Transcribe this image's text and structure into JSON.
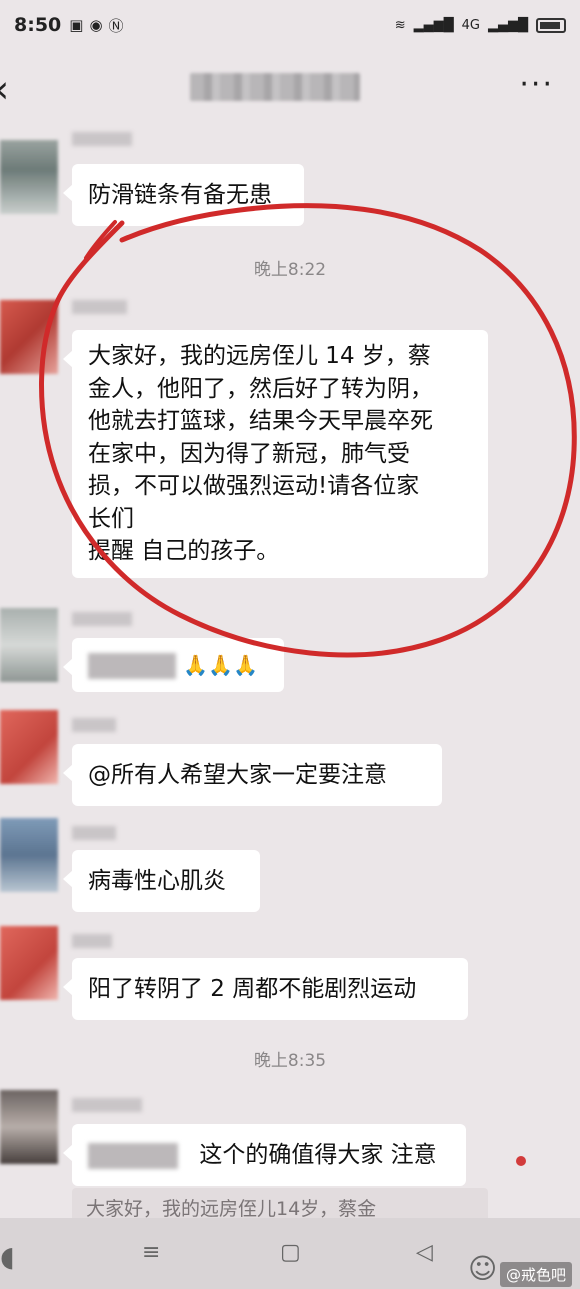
{
  "status_bar": {
    "time": "8:50",
    "signal_text": "4G"
  },
  "nav": {
    "back_icon": "chevron-left-icon",
    "more_icon": "more-icon",
    "more_glyph": "···"
  },
  "messages": [
    {
      "text": "防滑链条有备无患"
    },
    {
      "text": "大家好，我的远房侄儿 14 岁，蔡\n金人，他阳了，然后好了转为阴，\n他就去打篮球，结果今天早晨卒死\n在家中，因为得了新冠，肺气受\n损，不可以做强烈运动!请各位家\n长们\n提醒 自己的孩子。"
    },
    {
      "text": "🙏🙏🙏"
    },
    {
      "text": "@所有人希望大家一定要注意"
    },
    {
      "text": "病毒性心肌炎"
    },
    {
      "text": "阳了转阴了 2 周都不能剧烈运动"
    },
    {
      "text": "这个的确值得大家 注意"
    }
  ],
  "timestamps": [
    "晚上8:22",
    "晚上8:35"
  ],
  "quote_preview": "大家好，我的远房侄儿14岁，蔡金",
  "watermark": "@戒色吧",
  "colors": {
    "background": "#ebe6e8",
    "bubble": "#ffffff",
    "annotation_red": "#d02a2a"
  }
}
